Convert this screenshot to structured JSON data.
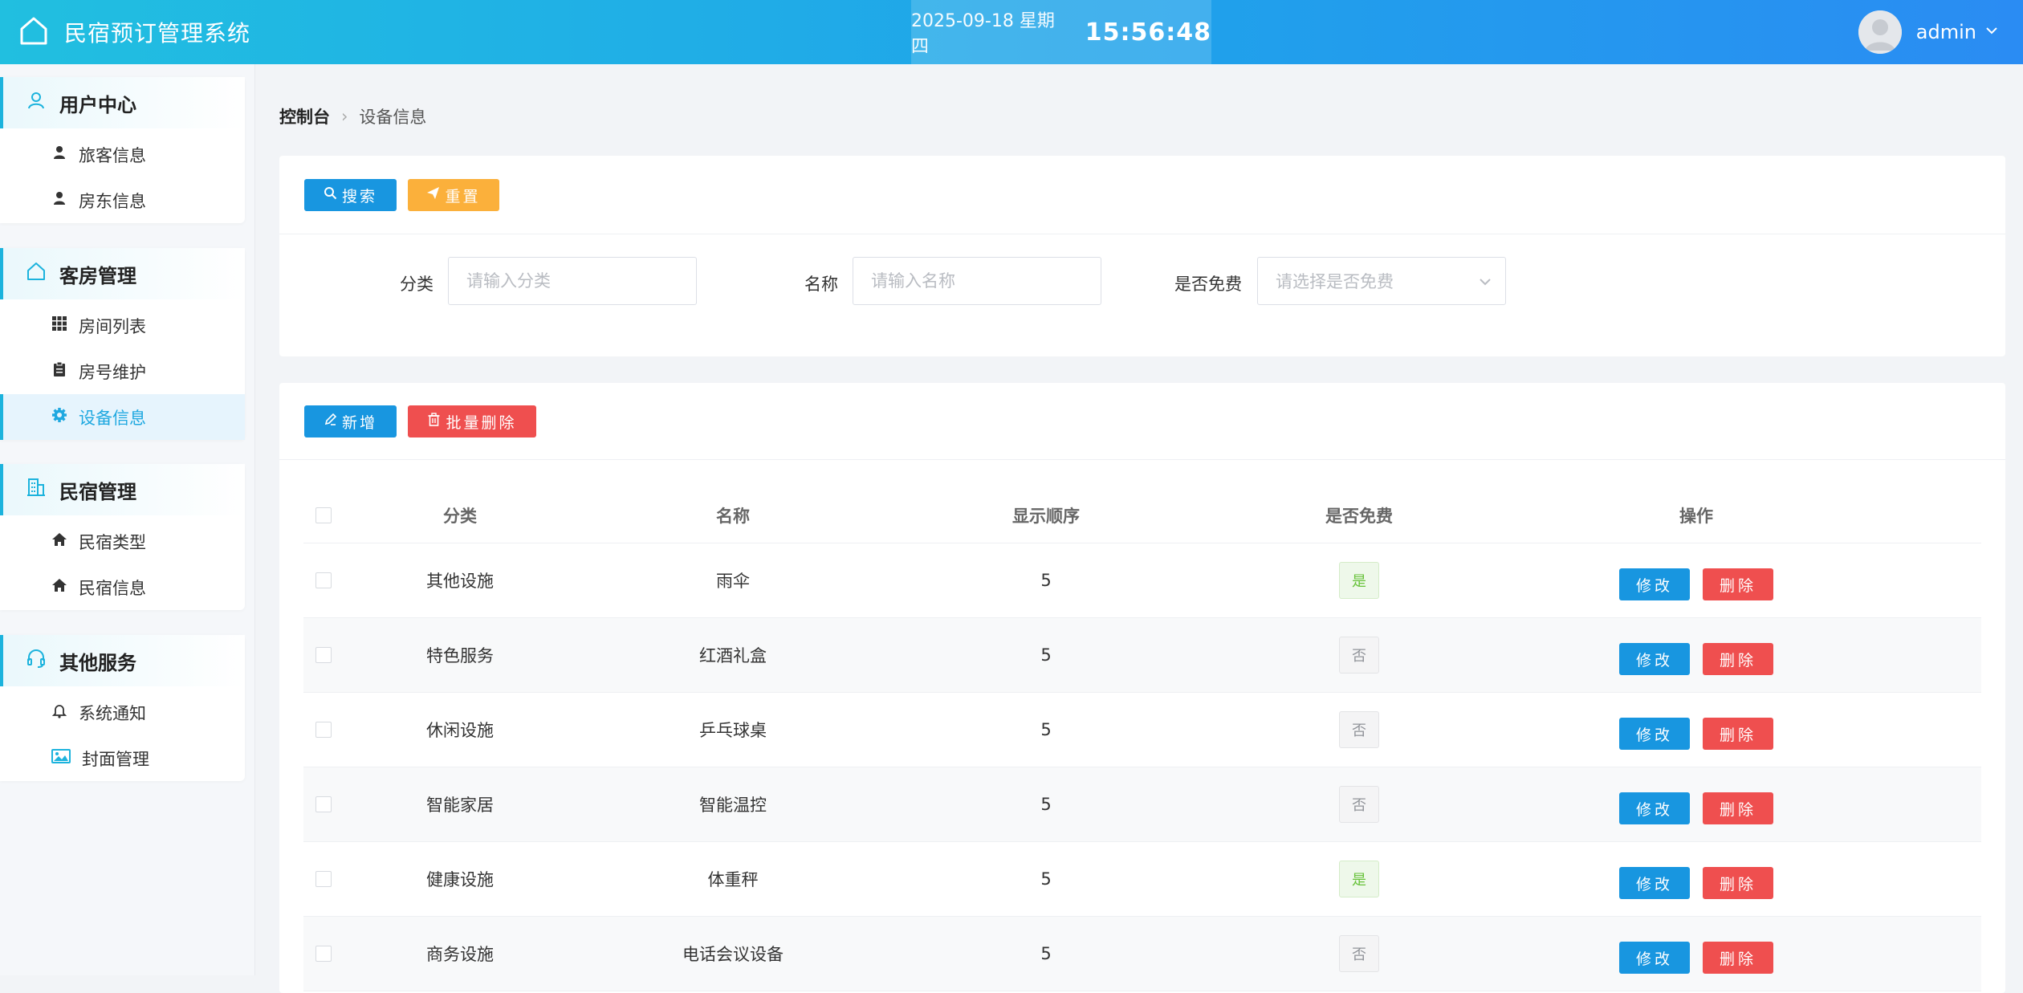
{
  "app": {
    "title": "民宿预订管理系统"
  },
  "clock": {
    "date": "2025-09-18 星期四",
    "time": "15:56:48"
  },
  "user": {
    "name": "admin"
  },
  "sidebar": {
    "groups": [
      {
        "title": "用户中心",
        "icon": "user-outline-icon",
        "items": [
          {
            "label": "旅客信息",
            "icon": "person-icon"
          },
          {
            "label": "房东信息",
            "icon": "person-icon"
          }
        ]
      },
      {
        "title": "客房管理",
        "icon": "home-outline-icon",
        "items": [
          {
            "label": "房间列表",
            "icon": "grid-icon"
          },
          {
            "label": "房号维护",
            "icon": "clipboard-icon"
          },
          {
            "label": "设备信息",
            "icon": "gear-icon",
            "active": true
          }
        ]
      },
      {
        "title": "民宿管理",
        "icon": "building-icon",
        "items": [
          {
            "label": "民宿类型",
            "icon": "house-icon"
          },
          {
            "label": "民宿信息",
            "icon": "house-icon"
          }
        ]
      },
      {
        "title": "其他服务",
        "icon": "headset-icon",
        "items": [
          {
            "label": "系统通知",
            "icon": "bell-icon"
          },
          {
            "label": "封面管理",
            "icon": "image-icon"
          }
        ]
      }
    ]
  },
  "breadcrumb": {
    "home": "控制台",
    "current": "设备信息"
  },
  "search": {
    "search_label": "搜索",
    "reset_label": "重置",
    "category_label": "分类",
    "category_placeholder": "请输入分类",
    "name_label": "名称",
    "name_placeholder": "请输入名称",
    "free_label": "是否免费",
    "free_placeholder": "请选择是否免费"
  },
  "toolbar": {
    "add_label": "新增",
    "batch_delete_label": "批量删除"
  },
  "table": {
    "headers": [
      "分类",
      "名称",
      "显示顺序",
      "是否免费",
      "操作"
    ],
    "edit_label": "修改",
    "delete_label": "删除",
    "rows": [
      {
        "category": "其他设施",
        "name": "雨伞",
        "order": "5",
        "free": "是"
      },
      {
        "category": "特色服务",
        "name": "红酒礼盒",
        "order": "5",
        "free": "否"
      },
      {
        "category": "休闲设施",
        "name": "乒乓球桌",
        "order": "5",
        "free": "否"
      },
      {
        "category": "智能家居",
        "name": "智能温控",
        "order": "5",
        "free": "否"
      },
      {
        "category": "健康设施",
        "name": "体重秤",
        "order": "5",
        "free": "是"
      },
      {
        "category": "商务设施",
        "name": "电话会议设备",
        "order": "5",
        "free": "否"
      }
    ]
  },
  "colors": {
    "accent": "#1cb3dd",
    "primary_button": "#1896e0",
    "warning_button": "#fbb03b",
    "danger_button": "#ef4f4f"
  }
}
